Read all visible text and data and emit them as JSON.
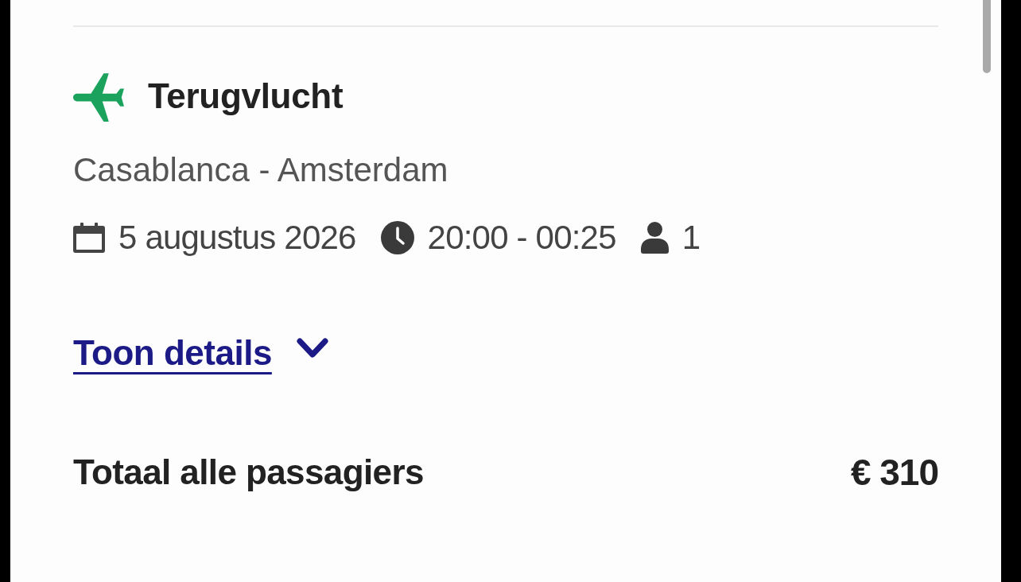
{
  "flight": {
    "title": "Terugvlucht",
    "route": "Casablanca - Amsterdam",
    "date": "5 augustus 2026",
    "time": "20:00 - 00:25",
    "passengers": "1"
  },
  "details_link": {
    "label": "Toon details",
    "expanded": false
  },
  "total": {
    "label": "Totaal alle passagiers",
    "amount": "€ 310"
  }
}
